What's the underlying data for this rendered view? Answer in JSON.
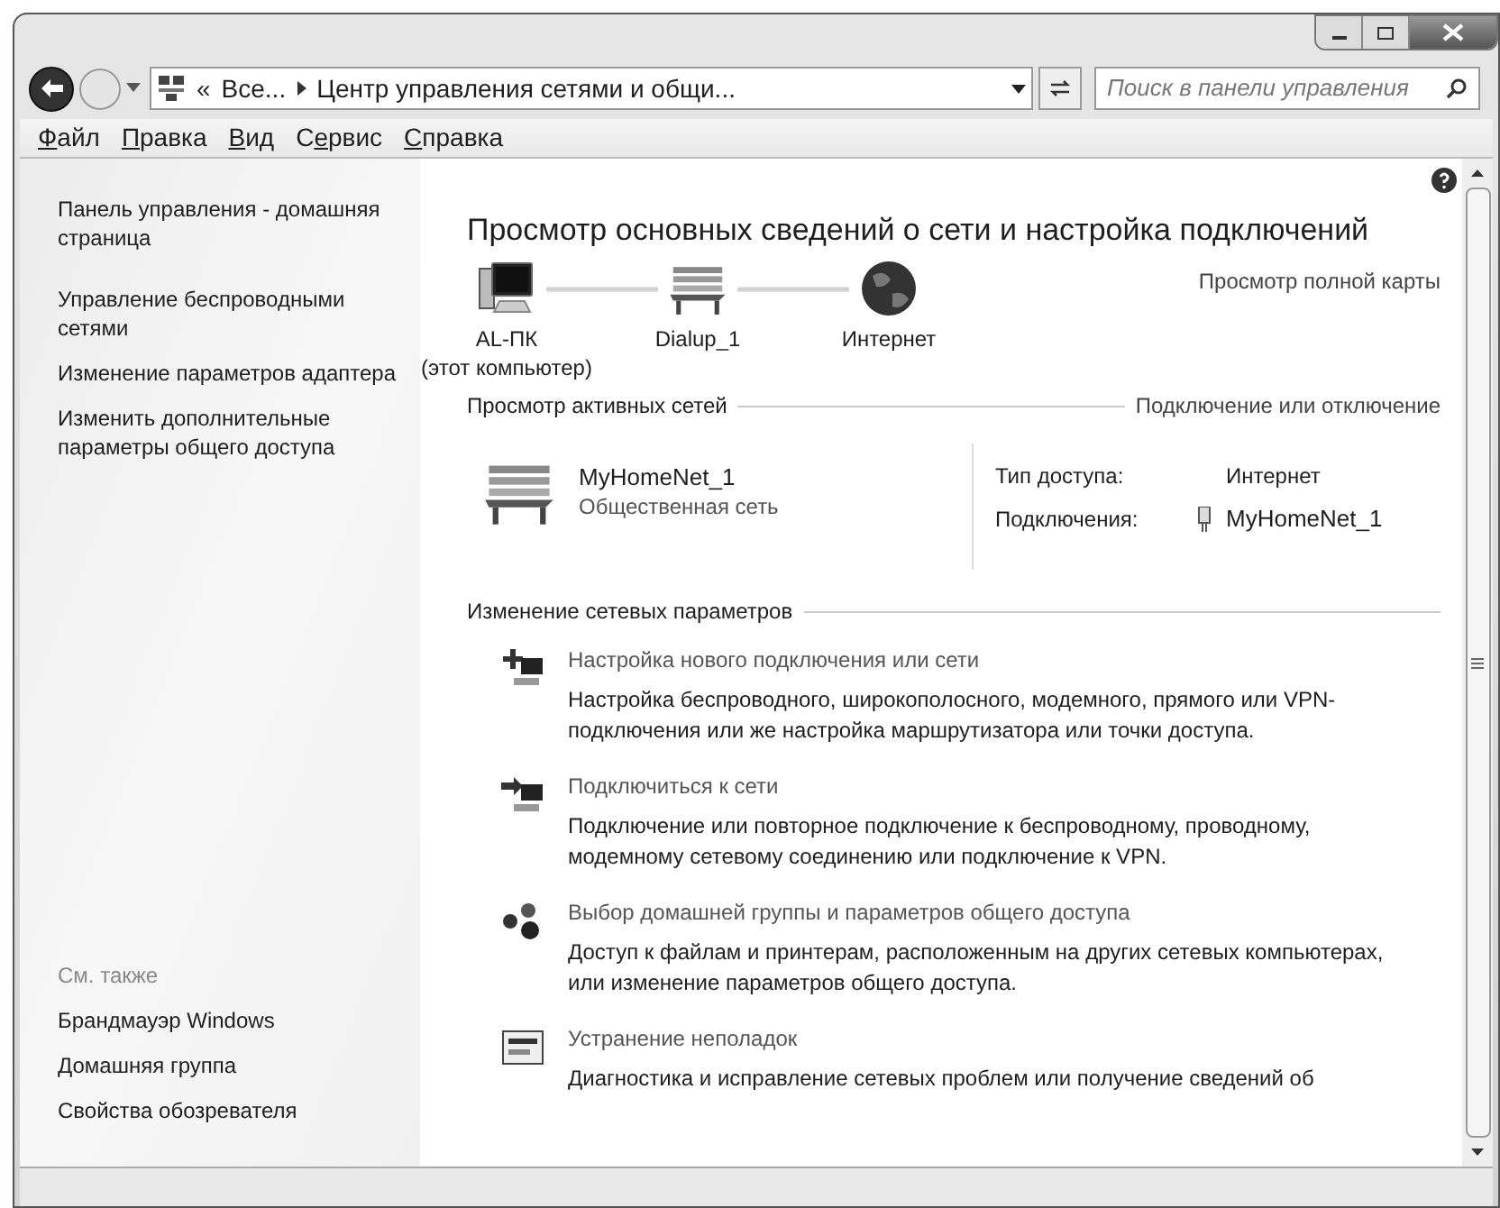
{
  "address_bar": {
    "overflow": "«",
    "crumbs": [
      "Все...",
      "Центр управления сетями и общи..."
    ]
  },
  "search": {
    "placeholder": "Поиск в панели управления"
  },
  "menu": [
    {
      "key": "Ф",
      "post": "айл"
    },
    {
      "key": "П",
      "post": "равка"
    },
    {
      "key": "В",
      "post": "ид"
    },
    {
      "pre": "С",
      "key": "е",
      "post": "рвис"
    },
    {
      "key": "С",
      "post": "правка"
    }
  ],
  "sidebar": {
    "links": [
      "Панель управления - домашняя страница",
      "Управление беспроводными сетями",
      "Изменение параметров адаптера",
      "Изменить дополнительные параметры общего доступа"
    ],
    "see_also": {
      "title": "См. также",
      "links": [
        "Брандмауэр Windows",
        "Домашняя группа",
        "Свойства обозревателя"
      ]
    }
  },
  "heading": "Просмотр основных сведений о сети и настройка подключений",
  "full_map_link": "Просмотр полной карты",
  "network_map": [
    {
      "kind": "computer",
      "label": "AL-ПК",
      "sublabel": "(этот компьютер)"
    },
    {
      "kind": "bench",
      "label": "Dialup_1"
    },
    {
      "kind": "globe",
      "label": "Интернет"
    }
  ],
  "active_networks": {
    "title": "Просмотр активных сетей",
    "link": "Подключение или отключение",
    "network": {
      "name": "MyHomeNet_1",
      "type": "Общественная сеть"
    },
    "details": [
      {
        "label": "Тип доступа:",
        "value": "Интернет",
        "kind": "text"
      },
      {
        "label": "Подключения:",
        "value": "MyHomeNet_1",
        "kind": "link"
      }
    ]
  },
  "change_settings": {
    "title": "Изменение сетевых параметров",
    "tasks": [
      {
        "kind": "new",
        "link": "Настройка нового подключения или сети",
        "description": "Настройка беспроводного, широкополосного, модемного, прямого или VPN-подключения или же настройка маршрутизатора или точки доступа."
      },
      {
        "kind": "connect",
        "link": "Подключиться к сети",
        "description": "Подключение или повторное подключение к беспроводному, проводному, модемному сетевому соединению или подключение к VPN."
      },
      {
        "kind": "homegroup",
        "link": "Выбор домашней группы и параметров общего доступа",
        "description": "Доступ к файлам и принтерам, расположенным на других сетевых компьютерах, или изменение параметров общего доступа."
      },
      {
        "kind": "troubleshoot",
        "link": "Устранение неполадок",
        "description": "Диагностика и исправление сетевых проблем или получение сведений об"
      }
    ]
  }
}
